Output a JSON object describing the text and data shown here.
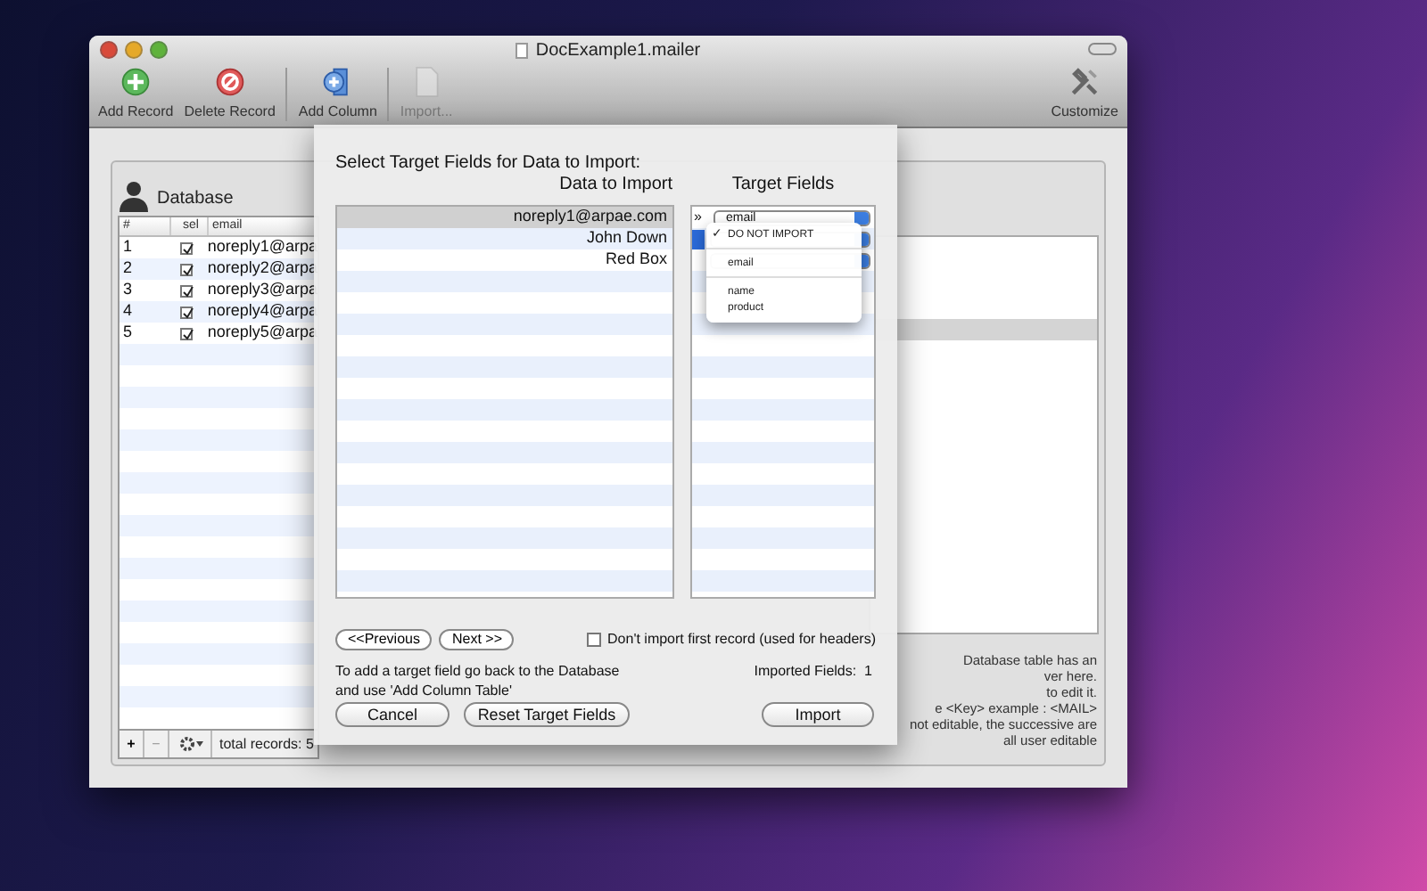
{
  "window": {
    "title": "DocExample1.mailer"
  },
  "toolbar": [
    {
      "label": "Add Record",
      "kind": "add",
      "disabled": false
    },
    {
      "label": "Delete Record",
      "kind": "delete",
      "disabled": false
    },
    {
      "label": "Add Column",
      "kind": "column",
      "disabled": false
    },
    {
      "label": "Import...",
      "kind": "import",
      "disabled": true
    },
    {
      "label": "Customize",
      "kind": "customize",
      "disabled": false
    }
  ],
  "database": {
    "title": "Database",
    "columns": [
      "#",
      "sel",
      "email"
    ],
    "rows": [
      {
        "number": "1",
        "checked": true,
        "email": "noreply1@arpa"
      },
      {
        "number": "2",
        "checked": true,
        "email": "noreply2@arpa"
      },
      {
        "number": "3",
        "checked": true,
        "email": "noreply3@arpa"
      },
      {
        "number": "4",
        "checked": true,
        "email": "noreply4@arpa"
      },
      {
        "number": "5",
        "checked": true,
        "email": "noreply5@arpa"
      }
    ],
    "footer": {
      "add": "+",
      "remove": "−",
      "total": "total records: 5"
    }
  },
  "key_panel": {
    "help": [
      "Database table has an",
      "ver here.",
      "to edit it.",
      "e <Key> example : <MAIL>",
      "not editable, the successive are",
      "all user editable"
    ]
  },
  "sheet": {
    "title": "Select Target Fields for Data to Import:",
    "data_header": "Data to Import",
    "target_header": "Target Fields",
    "rows": [
      {
        "data": "noreply1@arpae.com",
        "selected": true,
        "marker": "»",
        "target": "email",
        "active": false
      },
      {
        "data": "John Down",
        "selected": false,
        "active": true
      },
      {
        "data": "Red Box",
        "selected": false,
        "active": false
      }
    ],
    "previous": "<<Previous",
    "next": "Next >>",
    "skip_header": {
      "label": "Don't import first record (used for headers)",
      "checked": false
    },
    "hint": "To add a target field go back to the Database and use 'Add Column Table'",
    "imported": "Imported Fields:  1",
    "buttons": [
      "Cancel",
      "Reset Target Fields",
      "Import"
    ]
  },
  "menu": {
    "check_glyph": "✓",
    "items": [
      {
        "label": "DO NOT IMPORT",
        "checked": true,
        "separator_before": false
      },
      {
        "label": "email",
        "checked": false,
        "separator_before": true
      },
      {
        "label": "name",
        "checked": false,
        "separator_before": true
      },
      {
        "label": "product",
        "checked": false,
        "separator_before": false
      }
    ]
  }
}
